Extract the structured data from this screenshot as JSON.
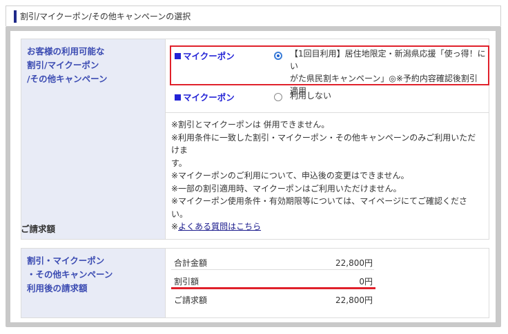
{
  "header": {
    "title": "割引/マイクーポン/その他キャンペーンの選択"
  },
  "coupon_section": {
    "label_lines": [
      "お客様の利用可能な",
      "割引/マイクーポン",
      "/その他キャンペーン"
    ],
    "options": [
      {
        "type_label": "マイクーポン",
        "selected": true,
        "text_lines": [
          "【1回目利用】居住地限定・新潟県応援「使っ得！にい",
          "がた県民割キャンペーン」◎※予約内容確認後割引",
          "適用"
        ]
      },
      {
        "type_label": "マイクーポン",
        "selected": false,
        "text_lines": [
          "利用しない"
        ]
      }
    ],
    "notes": [
      "※割引とマイクーポンは 併用できません。",
      "※利用条件に一致した割引・マイクーポン・その他キャンペーンのみご利用いただけま",
      "す。",
      "※マイクーポンのご利用について、申込後の変更はできません。",
      "※一部の割引適用時、マイクーポンはご利用いただけません。",
      "※マイクーポン使用条件・有効期限等については、マイページにてご確認ください。"
    ],
    "faq_prefix": "※",
    "faq_link": "よくある質問はこちら"
  },
  "billing": {
    "section_title": "ご請求額",
    "label_lines": [
      "割引・マイクーポン",
      "・その他キャンペーン",
      "利用後の請求額"
    ],
    "rows": [
      {
        "label": "合計金額",
        "value": "22,800円"
      },
      {
        "label": "割引額",
        "value": "0円"
      },
      {
        "label": "ご請求額",
        "value": "22,800円"
      }
    ]
  },
  "colors": {
    "accent_blue": "#2323d6",
    "highlight_red": "#e0202a",
    "label_bg": "#e8ebf6"
  }
}
